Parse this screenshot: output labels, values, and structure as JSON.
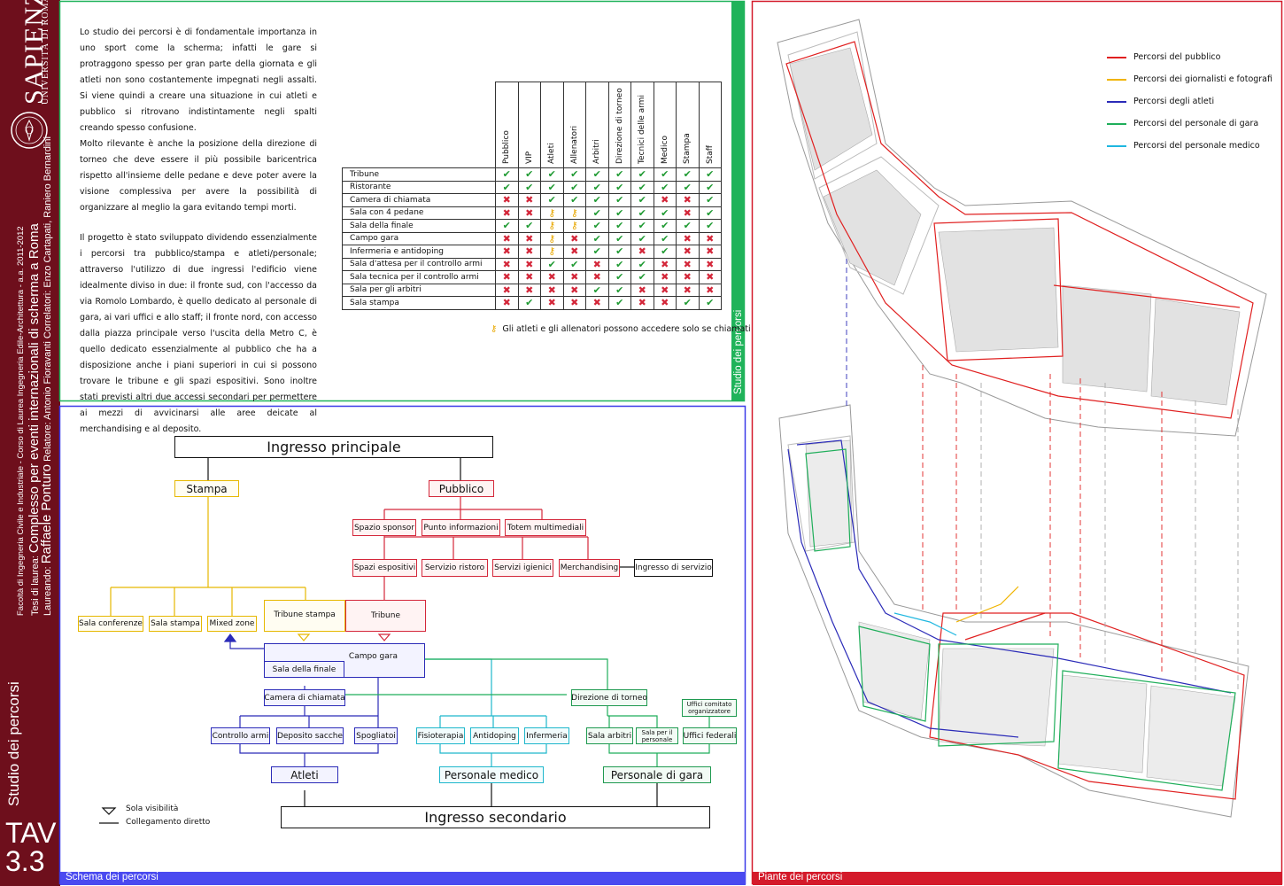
{
  "sidebar": {
    "logo_name": "SAPIENZA",
    "logo_sub": "UNIVERSITÀ DI ROMA",
    "line1": "Facoltà di Ingegneria Civile e Industriale  -  Corso di Laurea Ingegneria Edile-Architettura  -  a.a. 2011-2012",
    "line2_prefix": "Tesi di laurea:  ",
    "line2_title": "Complesso per eventi internazionali di scherma a Roma",
    "line3_prefix": "Laureando: ",
    "line3_name": "Raffaele Ponturo",
    "line3_rest": "   Relatore: Antonio Fioravanti   Correlatori: Enzo Cartapati, Raniero Bernardini",
    "section": "Studio dei percorsi",
    "tav": "TAV",
    "tav_num": "3.3"
  },
  "text": {
    "p1": "Lo studio dei percorsi è di fondamentale importanza in uno sport come la scherma; infatti le gare si protraggono spesso per gran parte della giornata e gli atleti non sono costantemente impegnati negli assalti. Si viene quindi a creare una situazione in cui atleti e pubblico si ritrovano indistintamente negli spalti creando spesso confusione.",
    "p2": "Molto rilevante è anche la posizione della direzione di torneo che deve essere il più possibile baricentrica rispetto all'insieme delle pedane e deve poter avere la visione complessiva per avere la possibilità di organizzare al meglio la gara evitando tempi morti.",
    "p3": "Il progetto è stato sviluppato dividendo essenzialmente i percorsi tra pubblico/stampa e atleti/personale; attraverso l'utilizzo di due ingressi l'edificio viene idealmente diviso in due: il fronte sud, con l'accesso da via Romolo Lombardo, è quello dedicato al personale di gara, ai vari uffici e allo staff; il fronte nord, con accesso dalla piazza principale verso l'uscita della Metro C, è quello dedicato essenzialmente al pubblico che ha a disposizione anche i piani superiori in cui si possono trovare le tribune e gli spazi espositivi. Sono inoltre stati previsti altri due accessi secondari per permettere ai mezzi di avvicinarsi alle aree deicate al merchandising e al deposito."
  },
  "table": {
    "columns": [
      "Pubblico",
      "VIP",
      "Atleti",
      "Allenatori",
      "Arbitri",
      "Direzione di torneo",
      "Tecnici delle armi",
      "Medico",
      "Stampa",
      "Staff"
    ],
    "rows": [
      {
        "label": "Tribune",
        "v": [
          "y",
          "y",
          "y",
          "y",
          "y",
          "y",
          "y",
          "y",
          "y",
          "y"
        ]
      },
      {
        "label": "Ristorante",
        "v": [
          "y",
          "y",
          "y",
          "y",
          "y",
          "y",
          "y",
          "y",
          "y",
          "y"
        ]
      },
      {
        "label": "Camera di chiamata",
        "v": [
          "n",
          "n",
          "y",
          "y",
          "y",
          "y",
          "y",
          "n",
          "n",
          "y"
        ]
      },
      {
        "label": "Sala con 4 pedane",
        "v": [
          "n",
          "n",
          "c",
          "c",
          "y",
          "y",
          "y",
          "y",
          "n",
          "y"
        ]
      },
      {
        "label": "Sala della finale",
        "v": [
          "y",
          "y",
          "c",
          "c",
          "y",
          "y",
          "y",
          "y",
          "y",
          "y"
        ]
      },
      {
        "label": "Campo gara",
        "v": [
          "n",
          "n",
          "c",
          "n",
          "y",
          "y",
          "y",
          "y",
          "n",
          "n"
        ]
      },
      {
        "label": "Infermeria e antidoping",
        "v": [
          "n",
          "n",
          "c",
          "n",
          "y",
          "y",
          "n",
          "y",
          "n",
          "n"
        ]
      },
      {
        "label": "Sala d'attesa per il controllo armi",
        "v": [
          "n",
          "n",
          "y",
          "y",
          "n",
          "y",
          "y",
          "n",
          "n",
          "n"
        ]
      },
      {
        "label": "Sala tecnica per il controllo armi",
        "v": [
          "n",
          "n",
          "n",
          "n",
          "n",
          "y",
          "y",
          "n",
          "n",
          "n"
        ]
      },
      {
        "label": "Sala per gli arbitri",
        "v": [
          "n",
          "n",
          "n",
          "n",
          "y",
          "y",
          "n",
          "n",
          "n",
          "n"
        ]
      },
      {
        "label": "Sala stampa",
        "v": [
          "n",
          "y",
          "n",
          "n",
          "n",
          "y",
          "n",
          "n",
          "y",
          "y"
        ]
      }
    ],
    "symbols": {
      "y": "✔",
      "n": "✖",
      "c": "⚷"
    },
    "note": "Gli atleti e gli allenatori possono accedere solo se chiamati"
  },
  "strips": {
    "studio": "Studio dei percorsi",
    "schema": "Schema dei percorsi",
    "piante": "Piante dei percorsi"
  },
  "legend": [
    {
      "label": "Percorsi del pubblico",
      "color": "#e02020"
    },
    {
      "label": "Percorsi dei giornalisti e fotografi",
      "color": "#f0b400"
    },
    {
      "label": "Percorsi degli atleti",
      "color": "#2b2bb8"
    },
    {
      "label": "Percorsi del personale di gara",
      "color": "#1fae5a"
    },
    {
      "label": "Percorsi del personale medico",
      "color": "#1fb7e0"
    }
  ],
  "diagram": {
    "ingresso_principale": "Ingresso principale",
    "stampa": "Stampa",
    "pubblico": "Pubblico",
    "spazio_sponsor": "Spazio sponsor",
    "punto_informazioni": "Punto informazioni",
    "totem": "Totem multimediali",
    "spazi_espositivi": "Spazi espositivi",
    "servizio_ristoro": "Servizio ristoro",
    "servizi_igienici": "Servizi igienici",
    "merchandising": "Merchandising",
    "ingresso_servizio": "Ingresso di servizio",
    "sala_conferenze": "Sala conferenze",
    "sala_stampa": "Sala stampa",
    "mixed_zone": "Mixed zone",
    "tribune_stampa": "Tribune stampa",
    "tribune": "Tribune",
    "campo_gara": "Campo gara",
    "sala_finale": "Sala della finale",
    "camera_chiamata": "Camera di chiamata",
    "direzione_torneo": "Direzione di torneo",
    "uffici_comitato": "Uffici comitato organizzatore",
    "controllo_armi": "Controllo armi",
    "deposito_sacche": "Deposito sacche",
    "spogliatoi": "Spogliatoi",
    "fisioterapia": "Fisioterapia",
    "antidoping": "Antidoping",
    "infermeria": "Infermeria",
    "sala_arbitri": "Sala arbitri",
    "sala_personale": "Sala per il personale",
    "uffici_federali": "Uffici federali",
    "atleti": "Atleti",
    "personale_medico": "Personale medico",
    "personale_gara": "Personale di gara",
    "ingresso_secondario": "Ingresso secondario",
    "leg_visibilita": "Sola visibilità",
    "leg_collegamento": "Collegamento diretto"
  }
}
